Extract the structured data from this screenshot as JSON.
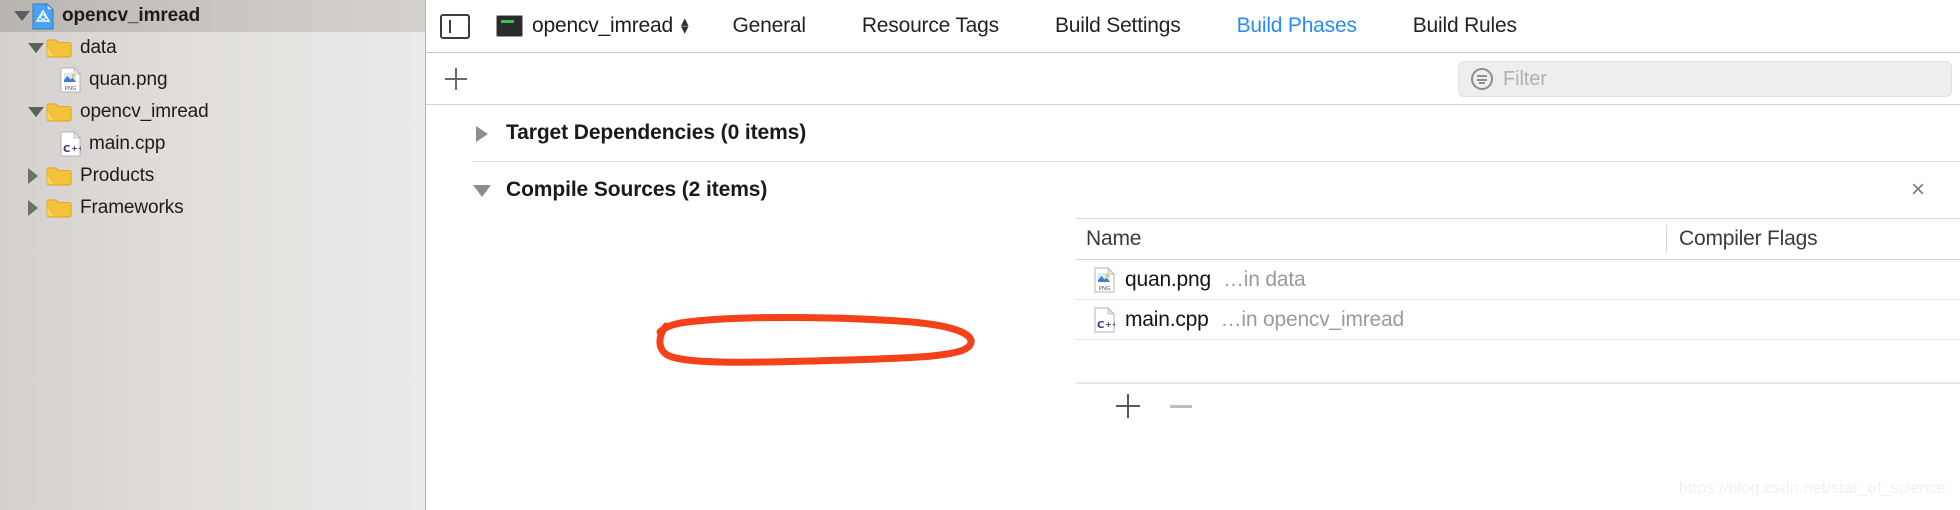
{
  "sidebar": {
    "project": {
      "name": "opencv_imread",
      "icon": "xcode-project-icon",
      "expanded": true
    },
    "items": [
      {
        "label": "data",
        "icon": "folder-icon",
        "kind": "folder",
        "expanded": true,
        "indent": 1
      },
      {
        "label": "quan.png",
        "icon": "png-file-icon",
        "kind": "file",
        "indent": 2
      },
      {
        "label": "opencv_imread",
        "icon": "folder-icon",
        "kind": "folder",
        "expanded": true,
        "indent": 1
      },
      {
        "label": "main.cpp",
        "icon": "cpp-file-icon",
        "kind": "file",
        "indent": 2
      },
      {
        "label": "Products",
        "icon": "folder-icon",
        "kind": "folder",
        "expanded": false,
        "indent": 1
      },
      {
        "label": "Frameworks",
        "icon": "folder-icon",
        "kind": "folder",
        "expanded": false,
        "indent": 1
      }
    ]
  },
  "toolbar": {
    "pane_toggle_icon": "navigator-pane-toggle-icon",
    "target": {
      "name": "opencv_imread",
      "icon": "target-app-icon",
      "stepper_icon": "up-down-chevron-icon"
    },
    "tabs": [
      {
        "label": "General",
        "active": false
      },
      {
        "label": "Resource Tags",
        "active": false
      },
      {
        "label": "Build Settings",
        "active": false
      },
      {
        "label": "Build Phases",
        "active": true
      },
      {
        "label": "Build Rules",
        "active": false
      }
    ],
    "active_tab_color": "#2a8cf0"
  },
  "filterbar": {
    "add_phase_icon": "plus-icon",
    "filter": {
      "placeholder": "Filter",
      "value": "",
      "icon": "filter-icon"
    }
  },
  "phases": [
    {
      "title": "Target Dependencies (0 items)",
      "expanded": false,
      "disclosure_icon": "triangle-right-icon"
    },
    {
      "title": "Compile Sources (2 items)",
      "expanded": true,
      "disclosure_icon": "triangle-down-icon",
      "close_icon": "×",
      "columns": [
        "Name",
        "Compiler Flags"
      ],
      "rows": [
        {
          "filename": "quan.png",
          "location": "…in data",
          "icon": "png-file-icon",
          "flags": ""
        },
        {
          "filename": "main.cpp",
          "location": "…in opencv_imread",
          "icon": "cpp-file-icon",
          "flags": ""
        }
      ],
      "footer": {
        "add_icon": "plus-icon",
        "remove_icon": "minus-icon"
      }
    }
  ],
  "annotation": {
    "shape": "hand-drawn-ellipse",
    "color": "#f4411a",
    "targets": "quan.png ...in data"
  },
  "watermark": {
    "text": "https://blog.csdn.net/star_of_science"
  }
}
